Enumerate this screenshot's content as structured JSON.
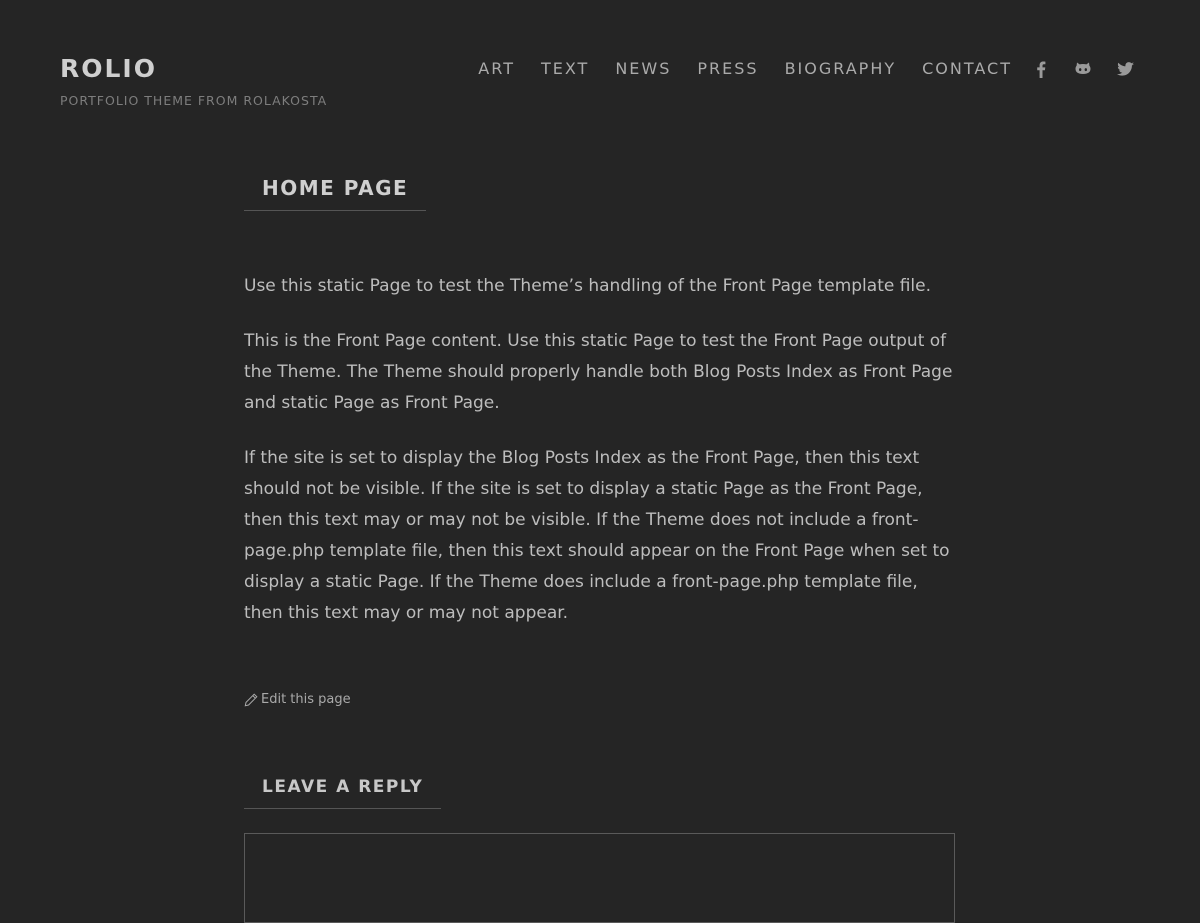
{
  "header": {
    "site_title": "ROLIO",
    "site_description": "PORTFOLIO THEME FROM ROLAKOSTA",
    "nav": [
      {
        "label": "ART"
      },
      {
        "label": "TEXT"
      },
      {
        "label": "NEWS"
      },
      {
        "label": "PRESS"
      },
      {
        "label": "BIOGRAPHY"
      },
      {
        "label": "CONTACT"
      }
    ],
    "social_icons": [
      "facebook-icon",
      "github-icon",
      "twitter-icon"
    ]
  },
  "page": {
    "title": "HOME PAGE",
    "paragraphs": [
      "Use this static Page to test the Theme’s handling of the Front Page template file.",
      "This is the Front Page content. Use this static Page to test the Front Page output of the Theme. The Theme should properly handle both Blog Posts Index as Front Page and static Page as Front Page.",
      "If the site is set to display the Blog Posts Index as the Front Page, then this text should not be visible. If the site is set to display a static Page as the Front Page, then this text may or may not be visible. If the Theme does not include a front-page.php template file, then this text should appear on the Front Page when set to display a static Page. If the Theme does include a front-page.php template file, then this text may or may not appear."
    ],
    "edit_link": "Edit this page",
    "edit_icon": "pencil-icon"
  },
  "comments": {
    "reply_title": "LEAVE A REPLY",
    "comment_value": ""
  },
  "colors": {
    "background": "#252525",
    "text": "#bdbdbd",
    "muted": "#7d7d7d"
  }
}
